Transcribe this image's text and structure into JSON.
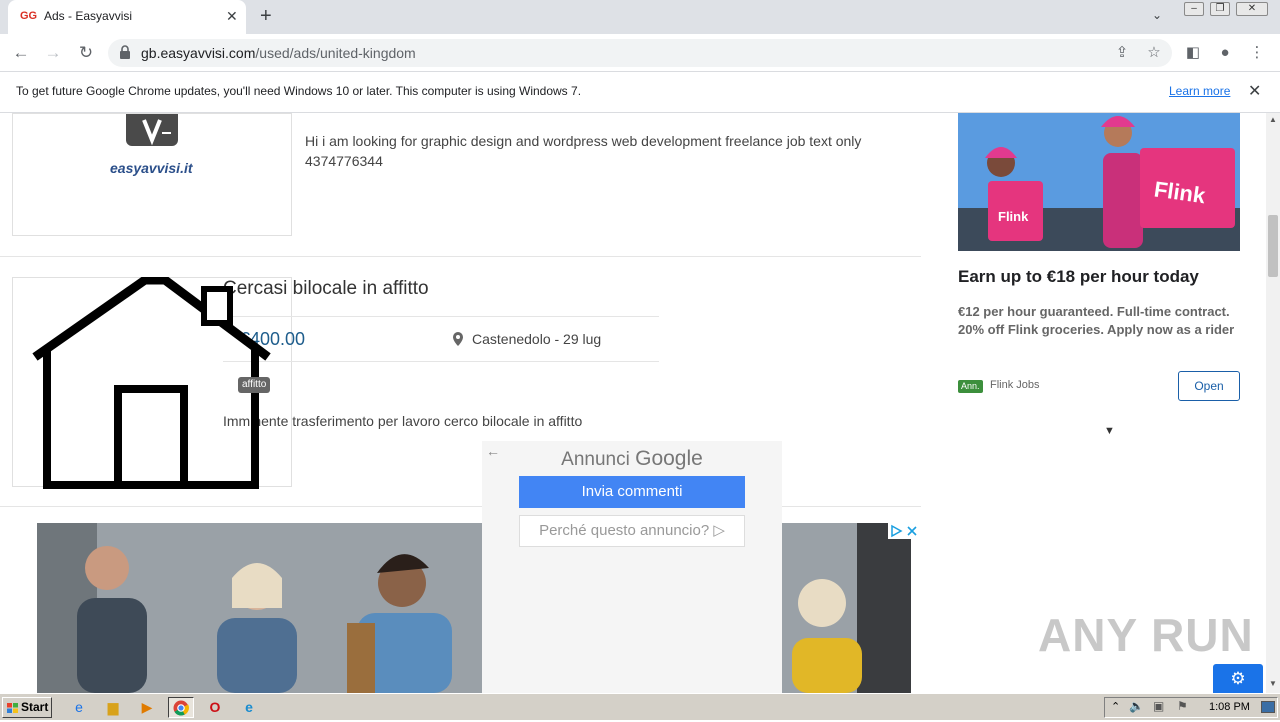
{
  "browser": {
    "tab_title": "Ads - Easyavvisi",
    "url_host": "gb.easyavvisi.com",
    "url_path": "/used/ads/united-kingdom",
    "infobar_text": "To get future Google Chrome updates, you'll need Windows 10 or later. This computer is using Windows 7.",
    "infobar_link": "Learn more"
  },
  "ads": [
    {
      "logo_text": "easyavvisi.it",
      "description": "Hi i am looking for graphic design and wordpress web development freelance job text only 4374776344"
    },
    {
      "title": "Cercasi bilocale in affitto",
      "price": "€400.00",
      "location": "Castenedolo - 29 lug",
      "tag": "affitto",
      "description": "Imminente trasferimento per lavoro  cerco bilocale in affitto"
    }
  ],
  "google_overlay": {
    "title_prefix": "Annunci",
    "title_brand": "Google",
    "feedback_button": "Invia commenti",
    "why_button": "Perché questo annuncio?"
  },
  "side_ad": {
    "image_brand": "Flink",
    "title": "Earn up to €18 per hour today",
    "body": "€12 per hour guaranteed. Full-time contract. 20% off Flink groceries. Apply now as a rider",
    "badge": "Ann.",
    "advertiser": "Flink Jobs",
    "open_button": "Open"
  },
  "watermark": "ANY RUN",
  "taskbar": {
    "start_label": "Start",
    "clock": "1:08 PM"
  }
}
